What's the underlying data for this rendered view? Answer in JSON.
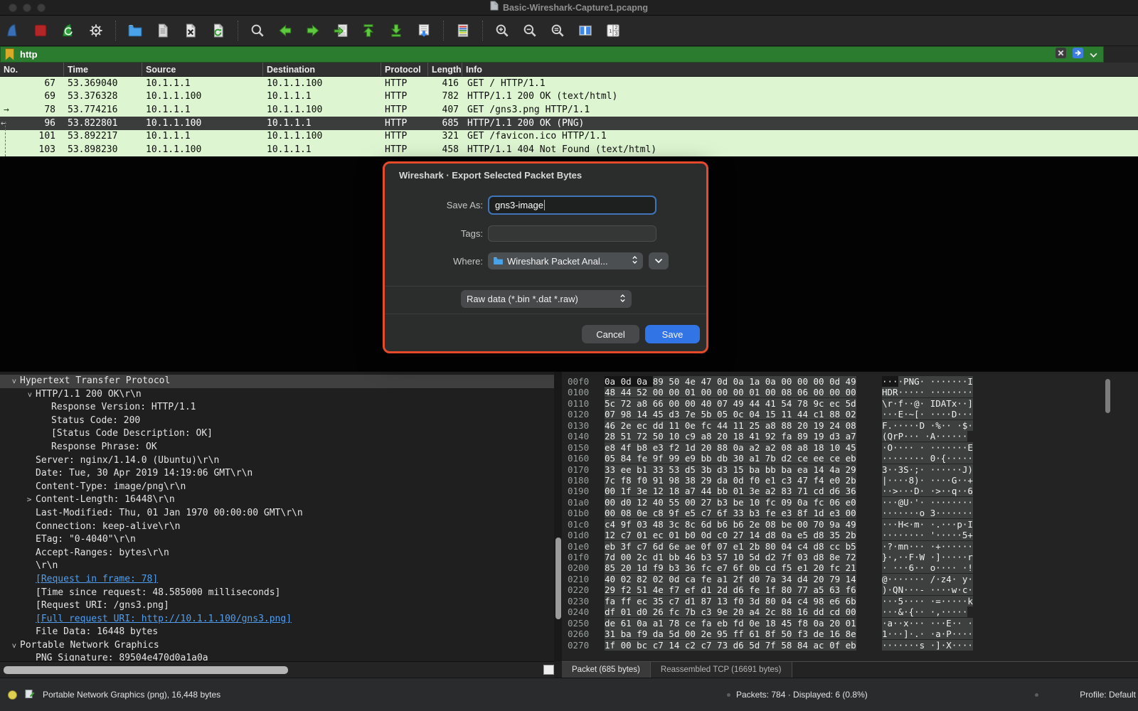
{
  "window": {
    "title": "Basic-Wireshark-Capture1.pcapng"
  },
  "toolbar": {
    "icons": [
      "wireshark-start",
      "stop-capture",
      "restart-capture",
      "capture-options",
      "sep",
      "open-file",
      "save-file",
      "close-file",
      "reload-file",
      "sep",
      "find-packet",
      "go-back",
      "go-forward",
      "go-to-packet",
      "go-to-top",
      "go-to-bottom",
      "auto-scroll",
      "sep",
      "colorize",
      "sep",
      "zoom-in",
      "zoom-out",
      "zoom-reset",
      "resize-columns",
      "layout-123"
    ]
  },
  "filter": {
    "value": "http",
    "valid_color": "#2c7c30"
  },
  "packet_list": {
    "columns": [
      "No.",
      "Time",
      "Source",
      "Destination",
      "Protocol",
      "Length",
      "Info"
    ],
    "row_color": "#ddf5d0",
    "selected_row_color": "#3b3d3c",
    "rows": [
      {
        "no": "67",
        "time": "53.369040",
        "src": "10.1.1.1",
        "dst": "10.1.1.100",
        "proto": "HTTP",
        "len": "416",
        "info": "GET / HTTP/1.1"
      },
      {
        "no": "69",
        "time": "53.376328",
        "src": "10.1.1.100",
        "dst": "10.1.1.1",
        "proto": "HTTP",
        "len": "782",
        "info": "HTTP/1.1 200 OK  (text/html)"
      },
      {
        "no": "78",
        "time": "53.774216",
        "src": "10.1.1.1",
        "dst": "10.1.1.100",
        "proto": "HTTP",
        "len": "407",
        "info": "GET /gns3.png HTTP/1.1",
        "marker": "request"
      },
      {
        "no": "96",
        "time": "53.822801",
        "src": "10.1.1.100",
        "dst": "10.1.1.1",
        "proto": "HTTP",
        "len": "685",
        "info": "HTTP/1.1 200 OK  (PNG)",
        "selected": true,
        "marker": "response"
      },
      {
        "no": "101",
        "time": "53.892217",
        "src": "10.1.1.1",
        "dst": "10.1.1.100",
        "proto": "HTTP",
        "len": "321",
        "info": "GET /favicon.ico HTTP/1.1"
      },
      {
        "no": "103",
        "time": "53.898230",
        "src": "10.1.1.100",
        "dst": "10.1.1.1",
        "proto": "HTTP",
        "len": "458",
        "info": "HTTP/1.1 404 Not Found  (text/html)"
      }
    ]
  },
  "dialog": {
    "title": "Wireshark · Export Selected Packet Bytes",
    "save_as_label": "Save As:",
    "save_as_value": "gns3-image",
    "tags_label": "Tags:",
    "tags_value": "",
    "where_label": "Where:",
    "where_value": "Wireshark Packet Anal...",
    "file_type_value": "Raw data (*.bin *.dat *.raw)",
    "cancel_label": "Cancel",
    "save_label": "Save",
    "highlight_color": "#e64a2b",
    "save_button_color": "#3174e6"
  },
  "detail_tree": {
    "lines": [
      {
        "d": 0,
        "exp": "v",
        "text": "Hypertext Transfer Protocol",
        "selected": true
      },
      {
        "d": 1,
        "exp": "v",
        "text": "HTTP/1.1 200 OK\\r\\n"
      },
      {
        "d": 2,
        "text": "Response Version: HTTP/1.1"
      },
      {
        "d": 2,
        "text": "Status Code: 200"
      },
      {
        "d": 2,
        "text": "[Status Code Description: OK]"
      },
      {
        "d": 2,
        "text": "Response Phrase: OK"
      },
      {
        "d": 1,
        "text": "Server: nginx/1.14.0 (Ubuntu)\\r\\n"
      },
      {
        "d": 1,
        "text": "Date: Tue, 30 Apr 2019 14:19:06 GMT\\r\\n"
      },
      {
        "d": 1,
        "text": "Content-Type: image/png\\r\\n"
      },
      {
        "d": 1,
        "exp": ">",
        "text": "Content-Length: 16448\\r\\n"
      },
      {
        "d": 1,
        "text": "Last-Modified: Thu, 01 Jan 1970 00:00:00 GMT\\r\\n"
      },
      {
        "d": 1,
        "text": "Connection: keep-alive\\r\\n"
      },
      {
        "d": 1,
        "text": "ETag: \"0-4040\"\\r\\n"
      },
      {
        "d": 1,
        "text": "Accept-Ranges: bytes\\r\\n"
      },
      {
        "d": 1,
        "text": "\\r\\n"
      },
      {
        "d": 1,
        "text": "[Request in frame: 78]",
        "link": true
      },
      {
        "d": 1,
        "text": "[Time since request: 48.585000 milliseconds]"
      },
      {
        "d": 1,
        "text": "[Request URI: /gns3.png]"
      },
      {
        "d": 1,
        "text": "[Full request URI: http://10.1.1.100/gns3.png]",
        "link": true
      },
      {
        "d": 1,
        "text": "File Data: 16448 bytes"
      },
      {
        "d": 0,
        "exp": "v",
        "text": "Portable Network Graphics"
      },
      {
        "d": 1,
        "text": "PNG Signature: 89504e470d0a1a0a"
      }
    ]
  },
  "hex_view": {
    "rows": [
      {
        "off": "00f0",
        "pre": "0a 0d 0a",
        "hex": "89 50 4e 47 0d  0a 1a 0a 00 00 00 0d 49",
        "apre": "···",
        "ascii": "·PNG· ·······I"
      },
      {
        "off": "0100",
        "hex": "48 44 52 00 00 01 00 00  00 01 00 08 06 00 00 00",
        "ascii": "HDR····· ········"
      },
      {
        "off": "0110",
        "hex": "5c 72 a8 66 00 00 40 07  49 44 41 54 78 9c ec 5d",
        "ascii": "\\r·f··@· IDATx··]"
      },
      {
        "off": "0120",
        "hex": "07 98 14 45 d3 7e 5b 05  0c 04 15 11 44 c1 88 02",
        "ascii": "···E·~[· ····D···"
      },
      {
        "off": "0130",
        "hex": "46 2e ec dd 11 0e fc 44  11 25 a8 88 20 19 24 08",
        "ascii": "F.·····D ·%·· ·$·"
      },
      {
        "off": "0140",
        "hex": "28 51 72 50 10 c9 a8 20  18 41 92 fa 89 19 d3 a7",
        "ascii": "(QrP···  ·A······"
      },
      {
        "off": "0150",
        "hex": "e8 4f b8 e3 f2 1d 20 88  0a a2 a2 08 a8 18 10 45",
        "ascii": "·O···· · ·······E"
      },
      {
        "off": "0160",
        "hex": "05 84 fe 9f 99 e9 bb db  30 a1 7b d2 ce ee ce eb",
        "ascii": "········ 0·{·····"
      },
      {
        "off": "0170",
        "hex": "33 ee b1 33 53 d5 3b d3  15 ba bb ba ea 14 4a 29",
        "ascii": "3··3S·;· ······J)"
      },
      {
        "off": "0180",
        "hex": "7c f8 f0 91 98 38 29 da  0d f0 e1 c3 47 f4 e0 2b",
        "ascii": "|····8)· ····G··+"
      },
      {
        "off": "0190",
        "hex": "00 1f 3e 12 18 a7 44 bb  01 3e a2 83 71 cd d6 36",
        "ascii": "··>···D· ·>··q··6"
      },
      {
        "off": "01a0",
        "hex": "00 d0 12 40 55 00 27 b3  be 10 fc 09 0a fc 06 e0",
        "ascii": "···@U·'· ········"
      },
      {
        "off": "01b0",
        "hex": "00 08 0e c8 9f e5 c7 6f  33 b3 fe e3 8f 1d e3 00",
        "ascii": "·······o 3·······"
      },
      {
        "off": "01c0",
        "hex": "c4 9f 03 48 3c 8c 6d b6  b6 2e 08 be 00 70 9a 49",
        "ascii": "···H<·m· ·.···p·I"
      },
      {
        "off": "01d0",
        "hex": "12 c7 01 ec 01 b0 0d c0  27 14 d8 0a e5 d8 35 2b",
        "ascii": "········ '·····5+"
      },
      {
        "off": "01e0",
        "hex": "eb 3f c7 6d 6e ae 0f 07  e1 2b 80 04 c4 d8 cc b5",
        "ascii": "·?·mn··· ·+······"
      },
      {
        "off": "01f0",
        "hex": "7d 00 2c d1 bb 46 b3 57  10 5d d2 7f 03 d8 8e 72",
        "ascii": "}·,··F·W ·]·····r"
      },
      {
        "off": "0200",
        "hex": "85 20 1d f9 b3 36 fc e7  6f 0b cd f5 e1 20 fc 21",
        "ascii": "· ···6·· o···· ·!"
      },
      {
        "off": "0210",
        "hex": "40 02 82 02 0d ca fe a1  2f d0 7a 34 d4 20 79 14",
        "ascii": "@······· /·z4· y·"
      },
      {
        "off": "0220",
        "hex": "29 f2 51 4e f7 ef d1 2d  d6 fe 1f 80 77 a5 63 f6",
        "ascii": ")·QN···- ····w·c·"
      },
      {
        "off": "0230",
        "hex": "fa ff ec 35 c7 d1 87 13  f0 3d 80 04 c4 98 e6 6b",
        "ascii": "···5···· ·=·····k"
      },
      {
        "off": "0240",
        "hex": "df 01 d0 26 fc 7b c3 9e  20 a4 2c 88 16 dd cd 00",
        "ascii": "···&·{··  ·,·····"
      },
      {
        "off": "0250",
        "hex": "de 61 0a a1 78 ce fa eb  fd 0e 18 45 f8 0a 20 01",
        "ascii": "·a··x··· ···E·· ·"
      },
      {
        "off": "0260",
        "hex": "31 ba f9 da 5d 00 2e 95  ff 61 8f 50 f3 de 16 8e",
        "ascii": "1···]·.· ·a·P····"
      },
      {
        "off": "0270",
        "hex": "1f 00 bc c7 14 c2 c7 73  d6 5d 7f 58 84 ac 0f eb",
        "ascii": "·······s ·]·X····"
      }
    ],
    "tabs": [
      {
        "label": "Packet (685 bytes)",
        "active": true
      },
      {
        "label": "Reassembled TCP (16691 bytes)",
        "active": false
      }
    ]
  },
  "status_bar": {
    "left": "Portable Network Graphics (png), 16,448 bytes",
    "center": "Packets: 784 · Displayed: 6 (0.8%)",
    "right": "Profile: Default"
  }
}
